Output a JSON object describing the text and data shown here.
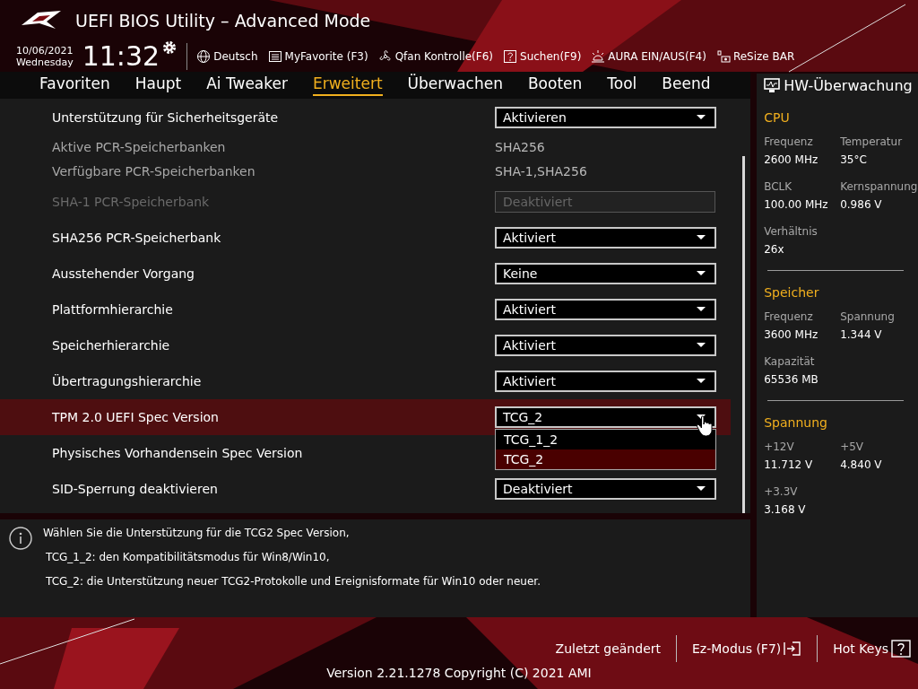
{
  "header": {
    "title": "UEFI BIOS Utility – Advanced Mode",
    "date": "10/06/2021",
    "weekday": "Wednesday",
    "time": "11:32",
    "toolbar": [
      {
        "kind": "globe",
        "label": "Deutsch"
      },
      {
        "kind": "list",
        "label": "MyFavorite (F3)"
      },
      {
        "kind": "fan",
        "label": "Qfan Kontrolle(F6)"
      },
      {
        "kind": "question",
        "label": "Suchen(F9)"
      },
      {
        "kind": "aura",
        "label": "AURA EIN/AUS(F4)"
      },
      {
        "kind": "resize",
        "label": "ReSize BAR"
      }
    ]
  },
  "tabs": [
    {
      "label": "Favoriten",
      "selected": false
    },
    {
      "label": "Haupt",
      "selected": false
    },
    {
      "label": "Ai Tweaker",
      "selected": false
    },
    {
      "label": "Erweitert",
      "selected": true
    },
    {
      "label": "Überwachen",
      "selected": false
    },
    {
      "label": "Booten",
      "selected": false
    },
    {
      "label": "Tool",
      "selected": false
    },
    {
      "label": "Beend",
      "selected": false
    }
  ],
  "settings": [
    {
      "kind": "dropdown",
      "label": "Unterstützung für Sicherheitsgeräte",
      "value": "Aktivieren",
      "disabled": false,
      "selected": false
    },
    {
      "kind": "info",
      "label": "Aktive PCR-Speicherbanken",
      "value": "SHA256"
    },
    {
      "kind": "info",
      "label": "Verfügbare PCR-Speicherbanken",
      "value": "SHA-1,SHA256"
    },
    {
      "kind": "field",
      "label": "SHA-1 PCR-Speicherbank",
      "value": "Deaktiviert",
      "disabled": true,
      "selected": false
    },
    {
      "kind": "dropdown",
      "label": "SHA256 PCR-Speicherbank",
      "value": "Aktiviert",
      "disabled": false,
      "selected": false
    },
    {
      "kind": "dropdown",
      "label": "Ausstehender Vorgang",
      "value": "Keine",
      "disabled": false,
      "selected": false
    },
    {
      "kind": "dropdown",
      "label": "Plattformhierarchie",
      "value": "Aktiviert",
      "disabled": false,
      "selected": false
    },
    {
      "kind": "dropdown",
      "label": "Speicherhierarchie",
      "value": "Aktiviert",
      "disabled": false,
      "selected": false
    },
    {
      "kind": "dropdown",
      "label": "Übertragungshierarchie",
      "value": "Aktiviert",
      "disabled": false,
      "selected": false
    },
    {
      "kind": "dropdown",
      "label": "TPM 2.0 UEFI Spec Version",
      "value": "TCG_2",
      "disabled": false,
      "selected": true,
      "expanded": true,
      "options": [
        {
          "label": "TCG_1_2",
          "selected": false
        },
        {
          "label": "TCG_2",
          "selected": true
        }
      ]
    },
    {
      "kind": "label",
      "label": "Physisches Vorhandensein Spec Version",
      "selected": false
    },
    {
      "kind": "dropdown",
      "label": "SID-Sperrung deaktivieren",
      "value": "Deaktiviert",
      "disabled": false,
      "selected": false
    }
  ],
  "help": {
    "lines": [
      "Wählen Sie die Unterstützung für die TCG2 Spec Version,",
      "TCG_1_2: den Kompatibilitätsmodus für Win8/Win10,",
      "TCG_2: die Unterstützung neuer TCG2-Protokolle und Ereignisformate für Win10 oder neuer."
    ]
  },
  "hw_monitor": {
    "title": "HW-Überwachung",
    "sections": [
      {
        "title": "CPU",
        "items": [
          {
            "label": "Frequenz",
            "value": "2600 MHz"
          },
          {
            "label": "Temperatur",
            "value": "35°C"
          },
          {
            "label": "BCLK",
            "value": "100.00 MHz"
          },
          {
            "label": "Kernspannung",
            "value": "0.986 V"
          },
          {
            "label": "Verhältnis",
            "value": "26x"
          }
        ]
      },
      {
        "title": "Speicher",
        "items": [
          {
            "label": "Frequenz",
            "value": "3600 MHz"
          },
          {
            "label": "Spannung",
            "value": "1.344 V"
          },
          {
            "label": "Kapazität",
            "value": "65536 MB"
          }
        ]
      },
      {
        "title": "Spannung",
        "items": [
          {
            "label": "+12V",
            "value": "11.712 V"
          },
          {
            "label": "+5V",
            "value": "4.840 V"
          },
          {
            "label": "+3.3V",
            "value": "3.168 V"
          }
        ]
      }
    ]
  },
  "footer": {
    "links": [
      {
        "kind": "text",
        "label": "Zuletzt geändert"
      },
      {
        "kind": "exit",
        "label": "Ez-Modus (F7)"
      },
      {
        "kind": "help",
        "label": "Hot Keys"
      }
    ],
    "version": "Version 2.21.1278 Copyright (C) 2021 AMI"
  }
}
